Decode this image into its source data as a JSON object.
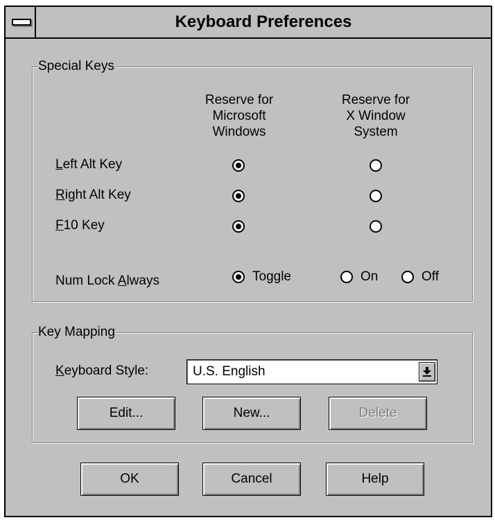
{
  "window": {
    "title": "Keyboard Preferences"
  },
  "special_keys": {
    "legend": "Special Keys",
    "columns": {
      "ms_windows": [
        "Reserve for",
        "Microsoft",
        "Windows"
      ],
      "x_window": [
        "Reserve for",
        "X Window",
        "System"
      ]
    },
    "rows": [
      {
        "key": "L",
        "rest": "eft Alt Key",
        "reserved_for": "Microsoft Windows"
      },
      {
        "key": "R",
        "rest": "ight Alt Key",
        "reserved_for": "Microsoft Windows"
      },
      {
        "key": "F",
        "rest": "10 Key",
        "reserved_for": "Microsoft Windows"
      }
    ],
    "num_lock": {
      "label_prefix": "Num Lock ",
      "label_key": "A",
      "label_rest": "lways",
      "options": [
        "Toggle",
        "On",
        "Off"
      ],
      "selected": "Toggle"
    }
  },
  "key_mapping": {
    "legend": "Key Mapping",
    "keyboard_style_key": "K",
    "keyboard_style_rest": "eyboard Style:",
    "keyboard_style_value": "U.S. English",
    "buttons": {
      "edit": "Edit...",
      "new": "New...",
      "delete": "Delete"
    }
  },
  "footer": {
    "ok": "OK",
    "cancel": "Cancel",
    "help": "Help"
  },
  "icons": {
    "system_menu": "system-menu-icon",
    "dropdown": "dropdown-arrow-icon"
  }
}
